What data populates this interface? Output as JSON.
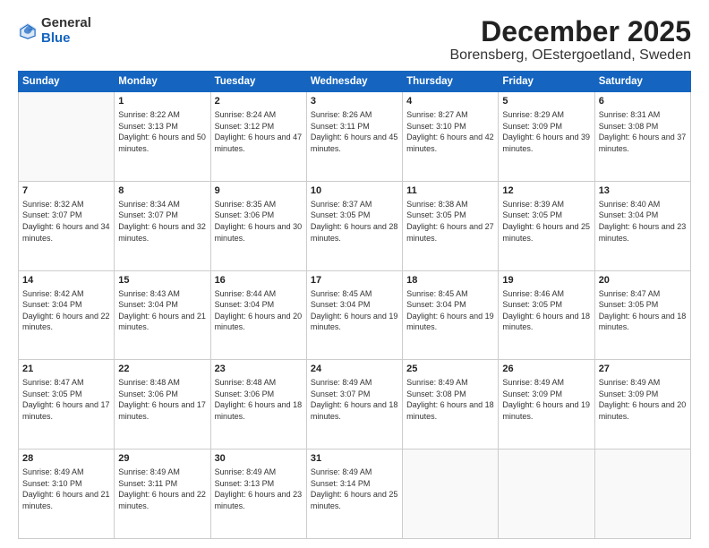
{
  "header": {
    "logo_general": "General",
    "logo_blue": "Blue",
    "month_title": "December 2025",
    "location": "Borensberg, OEstergoetland, Sweden"
  },
  "weekdays": [
    "Sunday",
    "Monday",
    "Tuesday",
    "Wednesday",
    "Thursday",
    "Friday",
    "Saturday"
  ],
  "weeks": [
    [
      {
        "day": "",
        "info": ""
      },
      {
        "day": "1",
        "info": "Sunrise: 8:22 AM\nSunset: 3:13 PM\nDaylight: 6 hours\nand 50 minutes."
      },
      {
        "day": "2",
        "info": "Sunrise: 8:24 AM\nSunset: 3:12 PM\nDaylight: 6 hours\nand 47 minutes."
      },
      {
        "day": "3",
        "info": "Sunrise: 8:26 AM\nSunset: 3:11 PM\nDaylight: 6 hours\nand 45 minutes."
      },
      {
        "day": "4",
        "info": "Sunrise: 8:27 AM\nSunset: 3:10 PM\nDaylight: 6 hours\nand 42 minutes."
      },
      {
        "day": "5",
        "info": "Sunrise: 8:29 AM\nSunset: 3:09 PM\nDaylight: 6 hours\nand 39 minutes."
      },
      {
        "day": "6",
        "info": "Sunrise: 8:31 AM\nSunset: 3:08 PM\nDaylight: 6 hours\nand 37 minutes."
      }
    ],
    [
      {
        "day": "7",
        "info": "Sunrise: 8:32 AM\nSunset: 3:07 PM\nDaylight: 6 hours\nand 34 minutes."
      },
      {
        "day": "8",
        "info": "Sunrise: 8:34 AM\nSunset: 3:07 PM\nDaylight: 6 hours\nand 32 minutes."
      },
      {
        "day": "9",
        "info": "Sunrise: 8:35 AM\nSunset: 3:06 PM\nDaylight: 6 hours\nand 30 minutes."
      },
      {
        "day": "10",
        "info": "Sunrise: 8:37 AM\nSunset: 3:05 PM\nDaylight: 6 hours\nand 28 minutes."
      },
      {
        "day": "11",
        "info": "Sunrise: 8:38 AM\nSunset: 3:05 PM\nDaylight: 6 hours\nand 27 minutes."
      },
      {
        "day": "12",
        "info": "Sunrise: 8:39 AM\nSunset: 3:05 PM\nDaylight: 6 hours\nand 25 minutes."
      },
      {
        "day": "13",
        "info": "Sunrise: 8:40 AM\nSunset: 3:04 PM\nDaylight: 6 hours\nand 23 minutes."
      }
    ],
    [
      {
        "day": "14",
        "info": "Sunrise: 8:42 AM\nSunset: 3:04 PM\nDaylight: 6 hours\nand 22 minutes."
      },
      {
        "day": "15",
        "info": "Sunrise: 8:43 AM\nSunset: 3:04 PM\nDaylight: 6 hours\nand 21 minutes."
      },
      {
        "day": "16",
        "info": "Sunrise: 8:44 AM\nSunset: 3:04 PM\nDaylight: 6 hours\nand 20 minutes."
      },
      {
        "day": "17",
        "info": "Sunrise: 8:45 AM\nSunset: 3:04 PM\nDaylight: 6 hours\nand 19 minutes."
      },
      {
        "day": "18",
        "info": "Sunrise: 8:45 AM\nSunset: 3:04 PM\nDaylight: 6 hours\nand 19 minutes."
      },
      {
        "day": "19",
        "info": "Sunrise: 8:46 AM\nSunset: 3:05 PM\nDaylight: 6 hours\nand 18 minutes."
      },
      {
        "day": "20",
        "info": "Sunrise: 8:47 AM\nSunset: 3:05 PM\nDaylight: 6 hours\nand 18 minutes."
      }
    ],
    [
      {
        "day": "21",
        "info": "Sunrise: 8:47 AM\nSunset: 3:05 PM\nDaylight: 6 hours\nand 17 minutes."
      },
      {
        "day": "22",
        "info": "Sunrise: 8:48 AM\nSunset: 3:06 PM\nDaylight: 6 hours\nand 17 minutes."
      },
      {
        "day": "23",
        "info": "Sunrise: 8:48 AM\nSunset: 3:06 PM\nDaylight: 6 hours\nand 18 minutes."
      },
      {
        "day": "24",
        "info": "Sunrise: 8:49 AM\nSunset: 3:07 PM\nDaylight: 6 hours\nand 18 minutes."
      },
      {
        "day": "25",
        "info": "Sunrise: 8:49 AM\nSunset: 3:08 PM\nDaylight: 6 hours\nand 18 minutes."
      },
      {
        "day": "26",
        "info": "Sunrise: 8:49 AM\nSunset: 3:09 PM\nDaylight: 6 hours\nand 19 minutes."
      },
      {
        "day": "27",
        "info": "Sunrise: 8:49 AM\nSunset: 3:09 PM\nDaylight: 6 hours\nand 20 minutes."
      }
    ],
    [
      {
        "day": "28",
        "info": "Sunrise: 8:49 AM\nSunset: 3:10 PM\nDaylight: 6 hours\nand 21 minutes."
      },
      {
        "day": "29",
        "info": "Sunrise: 8:49 AM\nSunset: 3:11 PM\nDaylight: 6 hours\nand 22 minutes."
      },
      {
        "day": "30",
        "info": "Sunrise: 8:49 AM\nSunset: 3:13 PM\nDaylight: 6 hours\nand 23 minutes."
      },
      {
        "day": "31",
        "info": "Sunrise: 8:49 AM\nSunset: 3:14 PM\nDaylight: 6 hours\nand 25 minutes."
      },
      {
        "day": "",
        "info": ""
      },
      {
        "day": "",
        "info": ""
      },
      {
        "day": "",
        "info": ""
      }
    ]
  ]
}
